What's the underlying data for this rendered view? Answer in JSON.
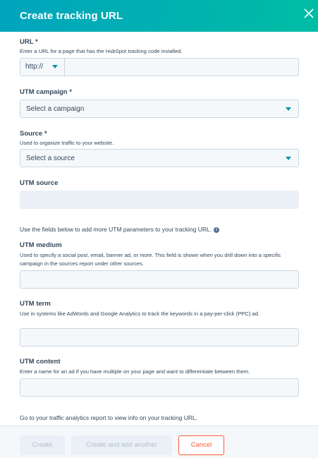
{
  "header": {
    "title": "Create tracking URL"
  },
  "url": {
    "label": "URL *",
    "help": "Enter a URL for a page that has the HubSpot tracking code installed.",
    "protocol": "http://",
    "value": ""
  },
  "campaign": {
    "label": "UTM campaign *",
    "selected": "Select a campaign"
  },
  "source": {
    "label": "Source *",
    "help": "Used to organize traffic to your website.",
    "selected": "Select a source"
  },
  "utm_source": {
    "label": "UTM source",
    "value": ""
  },
  "info": {
    "text": "Use the fields below to add more UTM parameters to your tracking URL."
  },
  "utm_medium": {
    "label": "UTM medium",
    "help": "Used to specify a social post, email, banner ad, or more. This field is shown when you drill down into a specific campaign in the sources report under other sources.",
    "value": ""
  },
  "utm_term": {
    "label": "UTM term",
    "help": "Use in systems like AdWords and Google Analytics to track the keywords in a pay-per-click (PPC) ad.",
    "value": ""
  },
  "utm_content": {
    "label": "UTM content",
    "help": "Enter a name for an ad if you have multiple on your page and want to differentiate between them.",
    "value": ""
  },
  "footer_note": {
    "text": "Go to your traffic analytics report to view info on your tracking URL."
  },
  "buttons": {
    "create": "Create",
    "create_another": "Create and add another",
    "cancel": "Cancel"
  },
  "colors": {
    "header_start": "#00a4bd",
    "header_end": "#00bda5",
    "accent": "#0091ae",
    "cancel": "#ff5c35"
  }
}
